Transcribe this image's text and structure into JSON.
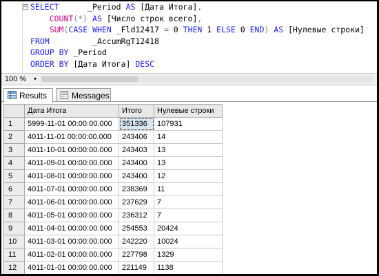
{
  "sql": {
    "lines": [
      [
        {
          "t": "SELECT",
          "c": "kw"
        },
        {
          "t": "      _Period ",
          "c": ""
        },
        {
          "t": "AS",
          "c": "kw"
        },
        {
          "t": " [Дата Итога]",
          "c": ""
        },
        {
          "t": ",",
          "c": "gr"
        }
      ],
      [
        {
          "t": "    ",
          "c": ""
        },
        {
          "t": "COUNT",
          "c": "fn"
        },
        {
          "t": "(*)",
          "c": "gr"
        },
        {
          "t": " ",
          "c": ""
        },
        {
          "t": "AS",
          "c": "kw"
        },
        {
          "t": " [Число строк всего]",
          "c": ""
        },
        {
          "t": ",",
          "c": "gr"
        }
      ],
      [
        {
          "t": "    ",
          "c": ""
        },
        {
          "t": "SUM",
          "c": "fn"
        },
        {
          "t": "(",
          "c": "gr"
        },
        {
          "t": "CASE",
          "c": "kw"
        },
        {
          "t": " ",
          "c": ""
        },
        {
          "t": "WHEN",
          "c": "kw"
        },
        {
          "t": " _Fld12417 ",
          "c": ""
        },
        {
          "t": "=",
          "c": "gr"
        },
        {
          "t": " 0 ",
          "c": ""
        },
        {
          "t": "THEN",
          "c": "kw"
        },
        {
          "t": " 1 ",
          "c": ""
        },
        {
          "t": "ELSE",
          "c": "kw"
        },
        {
          "t": " 0 ",
          "c": ""
        },
        {
          "t": "END",
          "c": "kw"
        },
        {
          "t": ")",
          "c": "gr"
        },
        {
          "t": " ",
          "c": ""
        },
        {
          "t": "AS",
          "c": "kw"
        },
        {
          "t": " [Нулевые строки]",
          "c": ""
        }
      ],
      [
        {
          "t": "FROM",
          "c": "kw"
        },
        {
          "t": "         _AccumRgT12418",
          "c": ""
        }
      ],
      [
        {
          "t": "GROUP",
          "c": "kw"
        },
        {
          "t": " ",
          "c": ""
        },
        {
          "t": "BY",
          "c": "kw"
        },
        {
          "t": " _Period",
          "c": ""
        }
      ],
      [
        {
          "t": "ORDER",
          "c": "kw"
        },
        {
          "t": " ",
          "c": ""
        },
        {
          "t": "BY",
          "c": "kw"
        },
        {
          "t": " [Дата Итога] ",
          "c": ""
        },
        {
          "t": "DESC",
          "c": "kw"
        }
      ]
    ],
    "collapse_glyph": "−"
  },
  "zoom": {
    "value": "100 %",
    "arrow": "▾"
  },
  "tabs": [
    {
      "label": "Results",
      "active": true,
      "icon": "results-grid-icon"
    },
    {
      "label": "Messages",
      "active": false,
      "icon": "messages-icon"
    }
  ],
  "grid": {
    "columns": [
      "Дата Итога",
      "Итого",
      "Нулевые строки"
    ],
    "selected_cell": {
      "row": 0,
      "col": 1
    },
    "rows": [
      [
        "1",
        "5999-11-01 00:00:00.000",
        "351336",
        "107931"
      ],
      [
        "2",
        "4011-11-01 00:00:00.000",
        "243406",
        "14"
      ],
      [
        "3",
        "4011-10-01 00:00:00.000",
        "243403",
        "13"
      ],
      [
        "4",
        "4011-09-01 00:00:00.000",
        "243400",
        "13"
      ],
      [
        "5",
        "4011-08-01 00:00:00.000",
        "243400",
        "12"
      ],
      [
        "6",
        "4011-07-01 00:00:00.000",
        "238369",
        "11"
      ],
      [
        "7",
        "4011-06-01 00:00:00.000",
        "237629",
        "7"
      ],
      [
        "8",
        "4011-05-01 00:00:00.000",
        "236312",
        "7"
      ],
      [
        "9",
        "4011-04-01 00:00:00.000",
        "254553",
        "20424"
      ],
      [
        "10",
        "4011-03-01 00:00:00.000",
        "242220",
        "10024"
      ],
      [
        "11",
        "4011-02-01 00:00:00.000",
        "227798",
        "1329"
      ],
      [
        "12",
        "4011-01-01 00:00:00.000",
        "221149",
        "1138"
      ]
    ]
  }
}
